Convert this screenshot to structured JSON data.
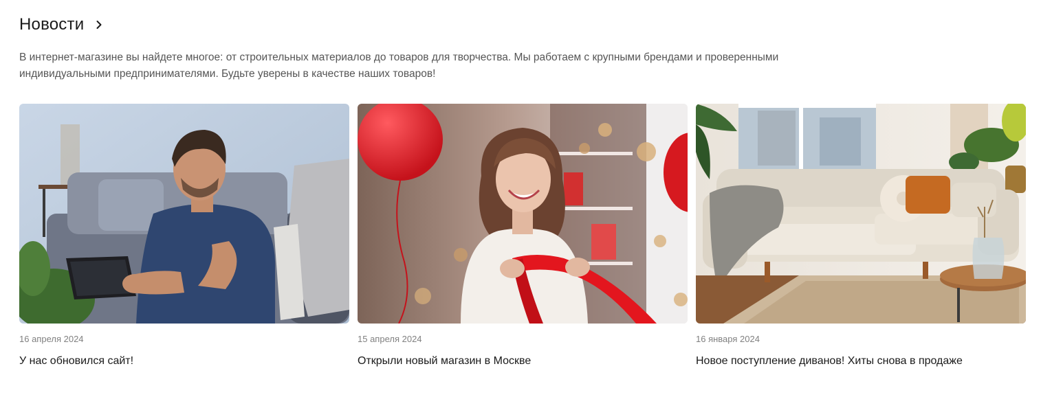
{
  "section": {
    "title": "Новости",
    "description": "В интернет-магазине вы найдете многое: от строительных материалов до товаров для творчества. Мы работаем с крупными брендами и проверенными индивидуальными предпринимателями. Будьте уверены в качестве наших товаров!"
  },
  "icons": {
    "header_chevron": "chevron-right-icon"
  },
  "colors": {
    "text_primary": "#1a1a1a",
    "text_secondary": "#555555",
    "date_text": "#808080",
    "accent_red": "#d9232b"
  },
  "news": [
    {
      "date": "16 апреля 2024",
      "title": "У нас обновился сайт!",
      "image_alt": "man-with-tablet-photo"
    },
    {
      "date": "15 апреля 2024",
      "title": "Открыли новый магазин в Москве",
      "image_alt": "woman-with-red-ribbon-photo"
    },
    {
      "date": "16 января 2024",
      "title": "Новое поступление диванов! Хиты снова в продаже",
      "image_alt": "beige-sofa-living-room-photo"
    }
  ]
}
